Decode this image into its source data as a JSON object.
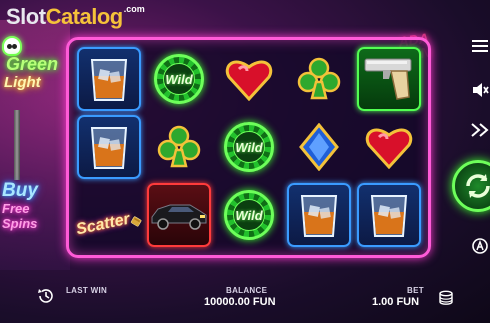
{
  "watermark": {
    "slot": "Slot",
    "catalog": "Catalog",
    "com": ".com"
  },
  "brand": {
    "line1": "Green",
    "line2": "Light"
  },
  "buy_feature": {
    "line1": "Buy",
    "line2": "Free Spins"
  },
  "background_sign": {
    "line1": "ADA",
    "line2": "BUN"
  },
  "grid": {
    "rows": [
      [
        {
          "symbol": "whiskey-glass",
          "frame": "blue"
        },
        {
          "symbol": "wild-chip",
          "label": "Wild"
        },
        {
          "symbol": "heart"
        },
        {
          "symbol": "club"
        },
        {
          "symbol": "pistol",
          "frame": "green"
        }
      ],
      [
        {
          "symbol": "whiskey-glass",
          "frame": "blue"
        },
        {
          "symbol": "club"
        },
        {
          "symbol": "wild-chip",
          "label": "Wild"
        },
        {
          "symbol": "diamond"
        },
        {
          "symbol": "heart"
        }
      ],
      [
        {
          "symbol": "scatter-lighter",
          "label": "Scatter"
        },
        {
          "symbol": "limousine",
          "frame": "red"
        },
        {
          "symbol": "wild-chip",
          "label": "Wild"
        },
        {
          "symbol": "whiskey-glass",
          "frame": "blue"
        },
        {
          "symbol": "whiskey-glass",
          "frame": "blue"
        }
      ]
    ]
  },
  "bottom": {
    "last_win_label": "LAST WIN",
    "balance_label": "BALANCE",
    "balance_value": "10000.00 FUN",
    "bet_label": "BET",
    "bet_value": "1.00 FUN"
  },
  "colors": {
    "frame": "#ff5bd8",
    "wild": "#3dff2a",
    "blue_frame": "#3a9bff",
    "red_frame": "#ff3b3b"
  },
  "icons": [
    "menu-icon",
    "sound-off-icon",
    "fast-forward-icon",
    "spin-icon",
    "autoplay-icon",
    "history-icon",
    "coins-icon"
  ]
}
